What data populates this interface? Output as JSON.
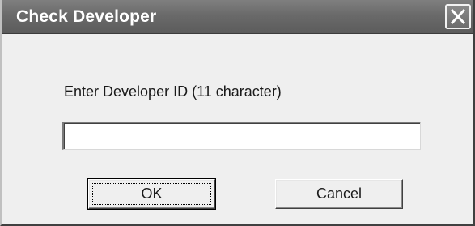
{
  "dialog": {
    "title": "Check Developer",
    "prompt": "Enter Developer ID (11 character)",
    "input_value": "",
    "ok_label": "OK",
    "cancel_label": "Cancel"
  },
  "icons": {
    "close": "close-icon"
  },
  "colors": {
    "titlebar": "#6a6a6a",
    "dialog_bg": "#efefef",
    "input_bg": "#ffffff",
    "text": "#1a1a1a"
  }
}
